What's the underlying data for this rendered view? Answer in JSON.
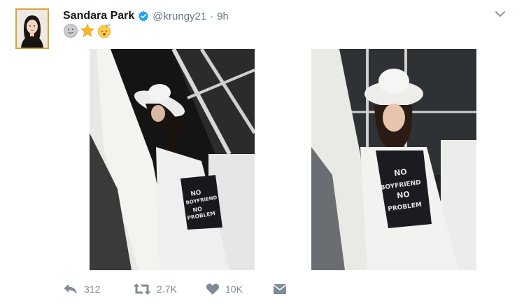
{
  "tweet": {
    "author_name": "Sandara Park",
    "handle": "@krungy21",
    "separator": "·",
    "time": "9h",
    "emojis": [
      "slightly-smiling-face",
      "star",
      "sleeping-face"
    ]
  },
  "photos": [
    {
      "shirt_text": [
        "NO",
        "BOYFRIEND",
        "NO",
        "PROBLEM"
      ]
    },
    {
      "shirt_text": [
        "NO",
        "BOYFRIEND",
        "NO",
        "PROBLEM"
      ]
    }
  ],
  "actions": {
    "reply_count": "312",
    "retweet_count": "2.7K",
    "like_count": "10K"
  },
  "colors": {
    "text_primary": "#14171a",
    "text_secondary": "#657786",
    "action_icon": "#7f8b96",
    "verified_blue": "#1da1f2",
    "avatar_border": "#d8a23a"
  }
}
